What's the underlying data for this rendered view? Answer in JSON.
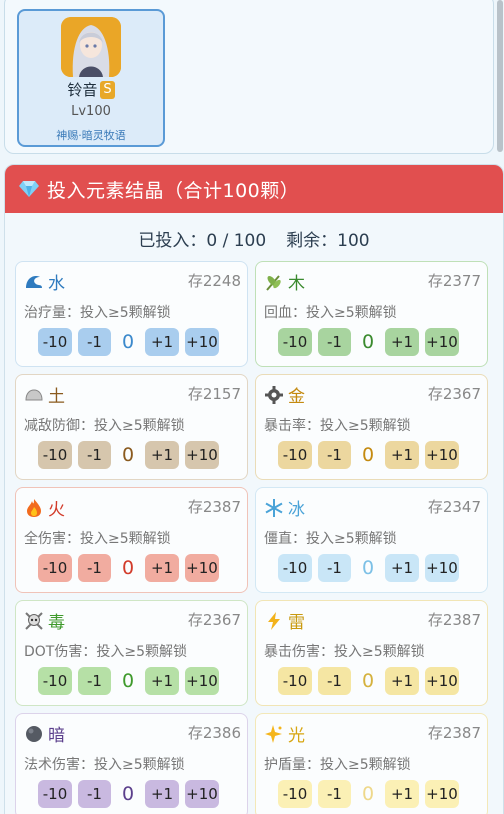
{
  "character": {
    "name": "铃音",
    "rank": "S",
    "level": "Lv100",
    "title": "神赐·暗灵牧语"
  },
  "invest": {
    "title": "投入元素结晶（合计100颗）",
    "invested_label": "已投入：0 / 100",
    "remaining_label": "剩余：100"
  },
  "elements": [
    {
      "key": "water",
      "name": "水",
      "icon": "wave-icon",
      "stock": "存2248",
      "effect": "治疗量：投入≥5颗解锁",
      "value": "0",
      "name_color": "#2f7bbf",
      "border": "#cfe3f2",
      "btn_bg": "#a9cdee",
      "val_color": "#3b89cc"
    },
    {
      "key": "wood",
      "name": "木",
      "icon": "leaf-icon",
      "stock": "存2377",
      "effect": "回血：投入≥5颗解锁",
      "value": "0",
      "name_color": "#3a8a2e",
      "border": "#bfe0b7",
      "btn_bg": "#a8d49f",
      "val_color": "#3a8a2e"
    },
    {
      "key": "earth",
      "name": "土",
      "icon": "rock-icon",
      "stock": "存2157",
      "effect": "减敌防御：投入≥5颗解锁",
      "value": "0",
      "name_color": "#8a5a1e",
      "border": "#e2d6c4",
      "btn_bg": "#d6c6ad",
      "val_color": "#8a5a1e"
    },
    {
      "key": "metal",
      "name": "金",
      "icon": "gear-icon",
      "stock": "存2367",
      "effect": "暴击率：投入≥5颗解锁",
      "value": "0",
      "name_color": "#c48a10",
      "border": "#eadcb8",
      "btn_bg": "#ecd79f",
      "val_color": "#c48a10"
    },
    {
      "key": "fire",
      "name": "火",
      "icon": "flame-icon",
      "stock": "存2387",
      "effect": "全伤害：投入≥5颗解锁",
      "value": "0",
      "name_color": "#d23b2a",
      "border": "#f0c3b8",
      "btn_bg": "#f1aca0",
      "val_color": "#d23b2a"
    },
    {
      "key": "ice",
      "name": "冰",
      "icon": "snowflake-icon",
      "stock": "存2347",
      "effect": "僵直：投入≥5颗解锁",
      "value": "0",
      "name_color": "#4aa3d8",
      "border": "#d3e8f4",
      "btn_bg": "#c9e6f7",
      "val_color": "#7cc0e6"
    },
    {
      "key": "poison",
      "name": "毒",
      "icon": "skull-icon",
      "stock": "存2367",
      "effect": "DOT伤害：投入≥5颗解锁",
      "value": "0",
      "name_color": "#3f9a2c",
      "border": "#cfe6c5",
      "btn_bg": "#b6e0a6",
      "val_color": "#3f9a2c"
    },
    {
      "key": "thunder",
      "name": "雷",
      "icon": "lightning-icon",
      "stock": "存2387",
      "effect": "暴击伤害：投入≥5颗解锁",
      "value": "0",
      "name_color": "#c99a10",
      "border": "#f1e5b5",
      "btn_bg": "#f5e6a3",
      "val_color": "#d5b23e"
    },
    {
      "key": "dark",
      "name": "暗",
      "icon": "dark-orb-icon",
      "stock": "存2386",
      "effect": "法术伤害：投入≥5颗解锁",
      "value": "0",
      "name_color": "#5b3f8c",
      "border": "#dcd3ea",
      "btn_bg": "#c9b9e0",
      "val_color": "#5b3f8c"
    },
    {
      "key": "light",
      "name": "光",
      "icon": "sparkle-icon",
      "stock": "存2387",
      "effect": "护盾量：投入≥5颗解锁",
      "value": "0",
      "name_color": "#d7a612",
      "border": "#f3e8b8",
      "btn_bg": "#fbf0b5",
      "val_color": "#eed88a"
    }
  ],
  "buttons": [
    "-10",
    "-1",
    "+1",
    "+10"
  ]
}
